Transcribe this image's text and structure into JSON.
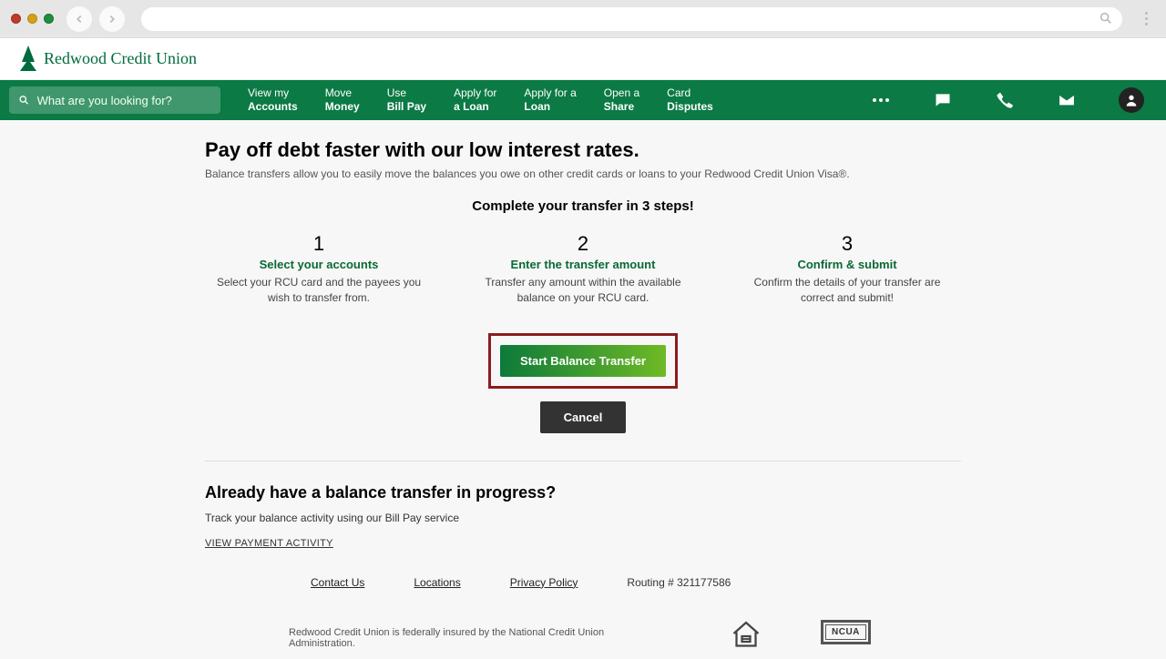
{
  "brand": {
    "name": "Redwood Credit Union"
  },
  "search": {
    "placeholder": "What are you looking for?"
  },
  "nav": {
    "items": [
      {
        "line1": "View my",
        "line2": "Accounts"
      },
      {
        "line1": "Move",
        "line2": "Money"
      },
      {
        "line1": "Use",
        "line2": "Bill Pay"
      },
      {
        "line1": "Apply for",
        "line2": "a Loan"
      },
      {
        "line1": "Apply for a",
        "line2": "Loan"
      },
      {
        "line1": "Open a",
        "line2": "Share"
      },
      {
        "line1": "Card",
        "line2": "Disputes"
      }
    ]
  },
  "main": {
    "title": "Pay off debt faster with our low interest rates.",
    "subtitle": "Balance transfers allow you to easily move the balances you owe on other credit cards or loans to your Redwood Credit Union Visa®.",
    "steps_heading": "Complete your transfer in 3 steps!",
    "steps": [
      {
        "num": "1",
        "name": "Select your accounts",
        "desc": "Select your RCU card and the payees you wish to transfer from."
      },
      {
        "num": "2",
        "name": "Enter the transfer amount",
        "desc": "Transfer any amount within the available balance on your RCU card."
      },
      {
        "num": "3",
        "name": "Confirm & submit",
        "desc": "Confirm the details of your transfer are correct and submit!"
      }
    ],
    "cta_start": "Start Balance Transfer",
    "cta_cancel": "Cancel",
    "progress_heading": "Already have a balance transfer in progress?",
    "progress_sub": "Track your balance activity using our Bill Pay service",
    "view_link": "VIEW PAYMENT ACTIVITY"
  },
  "footer": {
    "links": [
      "Contact Us",
      "Locations",
      "Privacy Policy"
    ],
    "routing": "Routing # 321177586",
    "insured": "Redwood Credit Union is federally insured by the National Credit Union Administration.",
    "ncua": "NCUA"
  }
}
